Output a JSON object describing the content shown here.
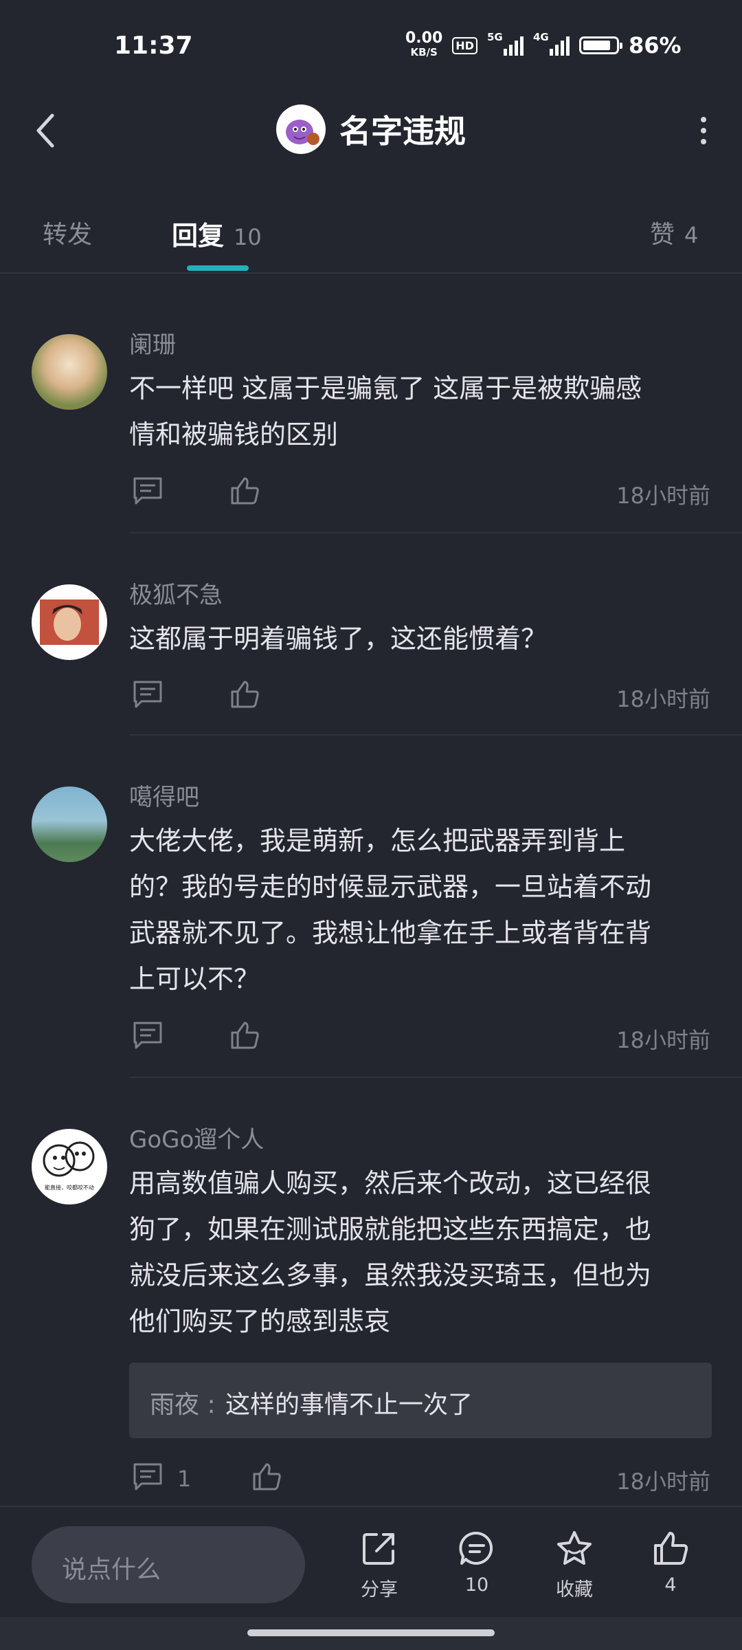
{
  "status_bar": {
    "time": "11:37",
    "net_speed": "0.00",
    "net_unit": "KB/S",
    "hd_label": "HD",
    "sig1_label": "5G",
    "sig2_label": "4G",
    "battery_percent": "86%",
    "battery_level": 0.86
  },
  "header": {
    "title": "名字违规"
  },
  "tabs": [
    {
      "label": "转发",
      "count": ""
    },
    {
      "label": "回复",
      "count": "10"
    },
    {
      "label": "赞",
      "count": "4"
    }
  ],
  "comments": [
    {
      "user": "阑珊",
      "text_lines": [
        "不一样吧 这属于是骗氪了 这属于是被欺骗感",
        "情和被骗钱的区别"
      ],
      "time": "18小时前"
    },
    {
      "user": "极狐不急",
      "text_lines": [
        "这都属于明着骗钱了，这还能惯着？"
      ],
      "time": "18小时前"
    },
    {
      "user": "噶得吧",
      "text_lines": [
        "大佬大佬，我是萌新，怎么把武器弄到背上",
        "的？我的号走的时候显示武器，一旦站着不动",
        "武器就不见了。我想让他拿在手上或者背在背",
        "上可以不？"
      ],
      "time": "18小时前"
    },
    {
      "user": "GoGo遛个人",
      "text_lines": [
        "用高数值骗人购买，然后来个改动，这已经很",
        "狗了，如果在测试服就能把这些东西搞定，也",
        "就没后来这么多事，虽然我没买琦玉，但也为",
        "他们购买了的感到悲哀"
      ],
      "reply": {
        "name": "雨夜",
        "sep": " : ",
        "text": "这样的事情不止一次了"
      },
      "reply_count": "1",
      "time": "18小时前"
    }
  ],
  "avatar4_caption": "能直接，咬都咬不动",
  "bottom_bar": {
    "input_placeholder": "说点什么",
    "share_label": "分享",
    "comment_count": "10",
    "favorite_label": "收藏",
    "like_count": "4"
  },
  "colors": {
    "background": "#23252f",
    "accent": "#22b1bd",
    "text": "#e4e5ea",
    "muted": "#8a8c96"
  }
}
